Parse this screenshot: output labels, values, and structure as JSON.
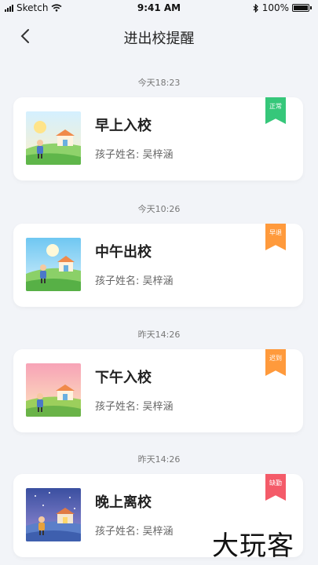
{
  "status_bar": {
    "carrier": "Sketch",
    "time": "9:41 AM",
    "battery": "100%"
  },
  "nav": {
    "title": "进出校提醒"
  },
  "events": [
    {
      "time": "今天18:23",
      "title": "早上入校",
      "child_label": "孩子姓名: 吴梓涵",
      "status": "正常",
      "status_color": "#36c77a",
      "scene": "morning"
    },
    {
      "time": "今天10:26",
      "title": "中午出校",
      "child_label": "孩子姓名: 吴梓涵",
      "status": "早退",
      "status_color": "#ff9a3c",
      "scene": "noon"
    },
    {
      "time": "昨天14:26",
      "title": "下午入校",
      "child_label": "孩子姓名: 吴梓涵",
      "status": "迟到",
      "status_color": "#ff9a3c",
      "scene": "afternoon"
    },
    {
      "time": "昨天14:26",
      "title": "晚上离校",
      "child_label": "孩子姓名: 吴梓涵",
      "status": "缺勤",
      "status_color": "#f45b69",
      "scene": "night"
    }
  ],
  "watermark": "大玩客"
}
